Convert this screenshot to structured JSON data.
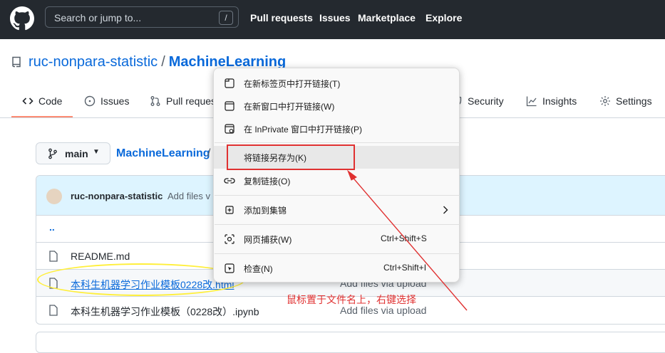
{
  "header": {
    "search_placeholder": "Search or jump to...",
    "search_shortcut": "/",
    "nav": [
      "Pull requests",
      "Issues",
      "Marketplace",
      "Explore"
    ]
  },
  "repo": {
    "owner": "ruc-nonpara-statistic",
    "separator": "/",
    "name": "MachineLearning"
  },
  "tabs": [
    {
      "label": "Code",
      "icon": "code-icon"
    },
    {
      "label": "Issues",
      "icon": "issue-icon"
    },
    {
      "label": "Pull reques",
      "icon": "pull-request-icon"
    },
    {
      "label": "Security",
      "icon": "shield-icon"
    },
    {
      "label": "Insights",
      "icon": "graph-icon"
    },
    {
      "label": "Settings",
      "icon": "gear-icon"
    }
  ],
  "branch": {
    "label": "main"
  },
  "breadcrumb": {
    "path": "MachineLearning",
    "sep": "/"
  },
  "commit": {
    "user": "ruc-nonpara-statistic",
    "message": "Add files v"
  },
  "files": [
    {
      "name": "..",
      "message": ""
    },
    {
      "name": "README.md",
      "message": ""
    },
    {
      "name": "本科生机器学习作业模板0228改.html",
      "message": "Add files via upload"
    },
    {
      "name": "本科生机器学习作业模板（0228改）.ipynb",
      "message": "Add files via upload"
    }
  ],
  "context_menu": {
    "items": [
      {
        "label": "在新标签页中打开链接(T)",
        "shortcut": "",
        "icon": "new-tab-icon"
      },
      {
        "label": "在新窗口中打开链接(W)",
        "shortcut": "",
        "icon": "new-window-icon"
      },
      {
        "label": "在 InPrivate 窗口中打开链接(P)",
        "shortcut": "",
        "icon": "inprivate-icon"
      },
      {
        "label": "将链接另存为(K)",
        "shortcut": "",
        "icon": ""
      },
      {
        "label": "复制链接(O)",
        "shortcut": "",
        "icon": "link-icon"
      },
      {
        "label": "添加到集锦",
        "shortcut": "",
        "icon": "collections-icon"
      },
      {
        "label": "网页捕获(W)",
        "shortcut": "Ctrl+Shift+S",
        "icon": "capture-icon"
      },
      {
        "label": "检查(N)",
        "shortcut": "Ctrl+Shift+I",
        "icon": "inspect-icon"
      }
    ]
  },
  "annotation": {
    "text": "鼠标置于文件名上，右键选择",
    "color": "#e03131"
  },
  "colors": {
    "header_bg": "#24292f",
    "link": "#0969da",
    "highlight_ellipse": "#ffef3a",
    "annotation_red": "#e03131"
  }
}
